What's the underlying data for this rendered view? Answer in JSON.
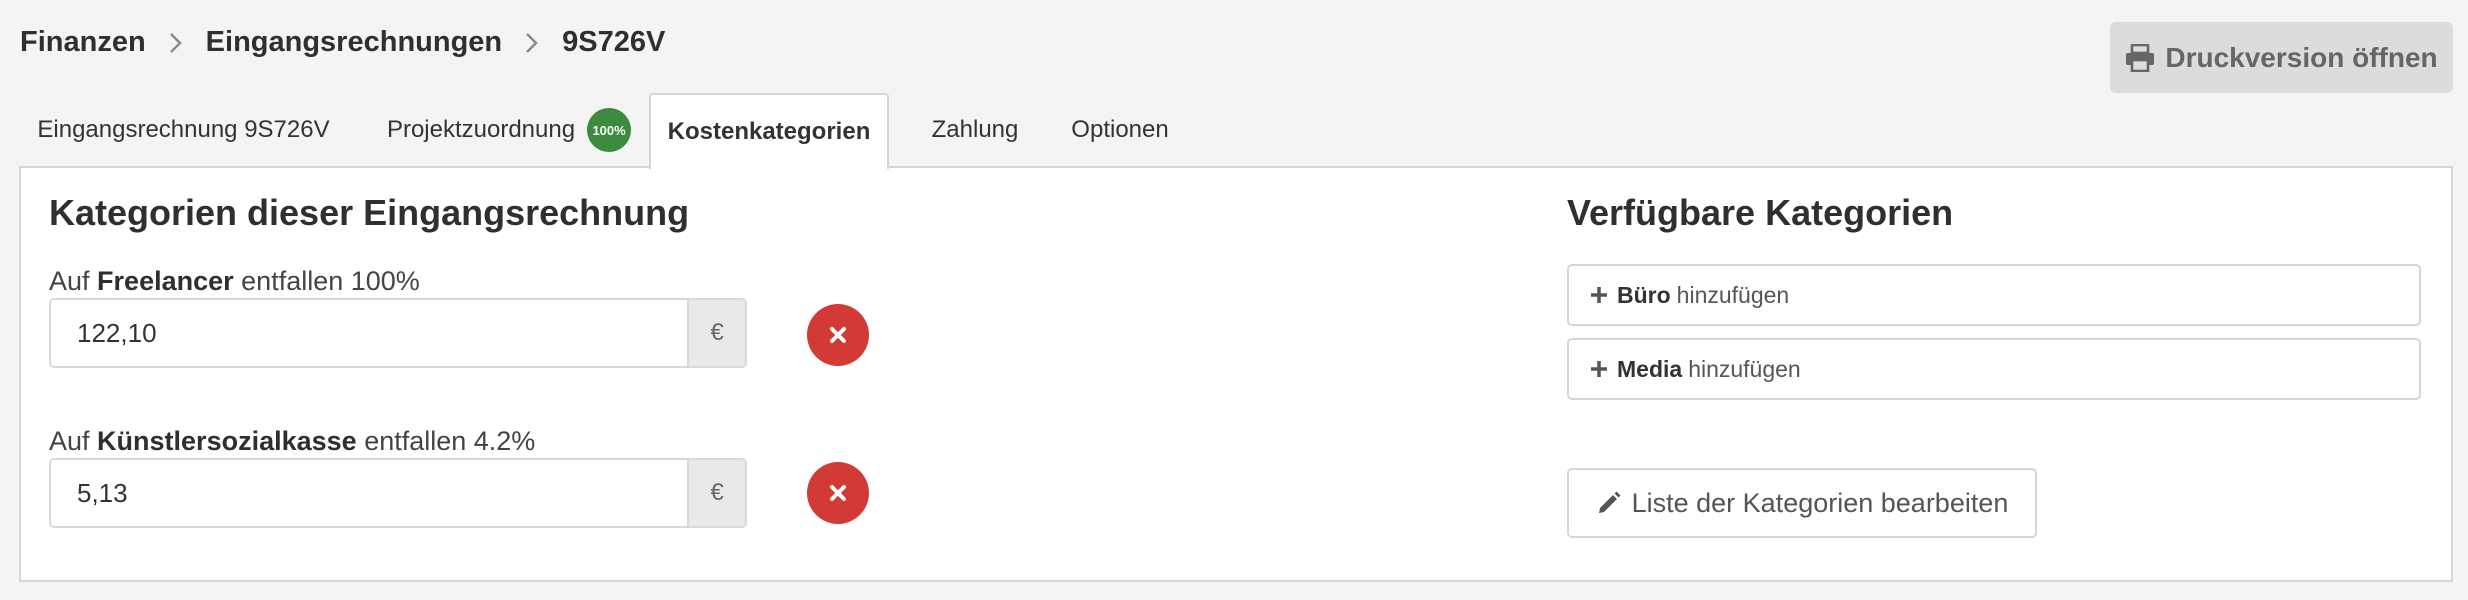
{
  "breadcrumb": {
    "items": [
      "Finanzen",
      "Eingangsrechnungen",
      "9S726V"
    ]
  },
  "header": {
    "print_button_label": "Druckversion öffnen",
    "print_icon": "printer-icon"
  },
  "tabs": [
    {
      "label": "Eingangsrechnung 9S726V",
      "active": false
    },
    {
      "label": "Projektzuordnung",
      "badge": "100%",
      "active": false
    },
    {
      "label": "Kostenkategorien",
      "active": true
    },
    {
      "label": "Zahlung",
      "active": false
    },
    {
      "label": "Optionen",
      "active": false
    }
  ],
  "main": {
    "title": "Kategorien dieser Eingangsrechnung",
    "categories": [
      {
        "prefix": "Auf",
        "name": "Freelancer",
        "suffix": "entfallen 100%",
        "value": "122,10",
        "currency": "€"
      },
      {
        "prefix": "Auf",
        "name": "Künstlersozialkasse",
        "suffix": "entfallen 4.2%",
        "value": "5,13",
        "currency": "€"
      }
    ]
  },
  "available": {
    "title": "Verfügbare Kategorien",
    "items": [
      {
        "name": "Büro",
        "action": "hinzufügen"
      },
      {
        "name": "Media",
        "action": "hinzufügen"
      }
    ],
    "edit_button_label": "Liste der Kategorien bearbeiten"
  },
  "colors": {
    "badge": "#3d8b40",
    "delete": "#d23a35",
    "print_button_bg": "#dcdcdc"
  }
}
